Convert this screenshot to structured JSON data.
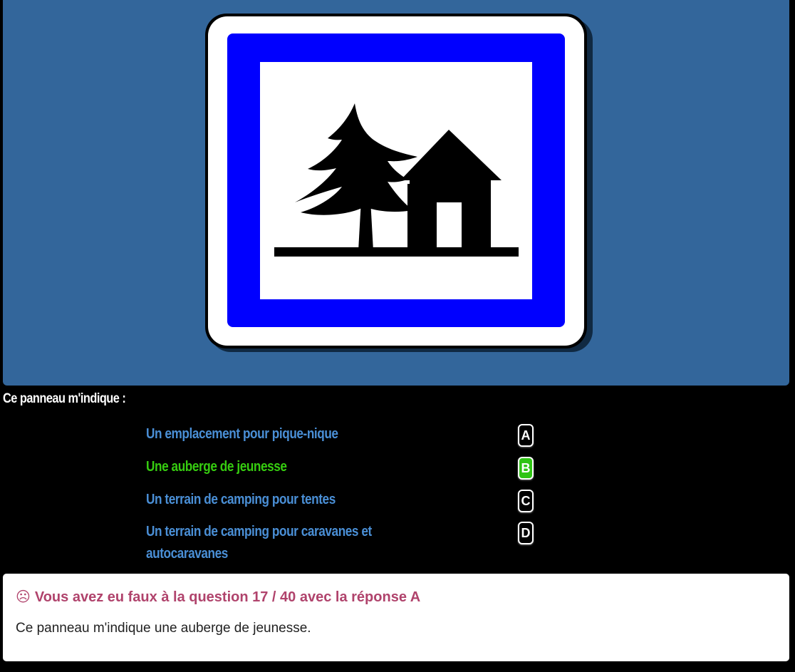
{
  "question": {
    "text": "Ce panneau m'indique :"
  },
  "sign": {
    "icon": "tree-and-house-sign-icon",
    "colors": {
      "background": "#33669b",
      "frame_blue": "#0000ff",
      "inner": "#ffffff",
      "symbol": "#000000"
    }
  },
  "answers": [
    {
      "key": "A",
      "label": "Un emplacement pour pique-nique",
      "state": "default"
    },
    {
      "key": "B",
      "label": "Une auberge de jeunesse",
      "state": "correct"
    },
    {
      "key": "C",
      "label": "Un terrain de camping pour tentes",
      "state": "default"
    },
    {
      "key": "D",
      "label": "Un terrain de camping pour caravanes et autocaravanes",
      "state": "default"
    }
  ],
  "feedback": {
    "icon": "sad-face-icon",
    "icon_glyph": "☹",
    "title": "Vous avez eu faux à la question 17 / 40 avec la réponse A",
    "explanation": "Ce panneau m'indique une auberge de jeunesse."
  },
  "colors": {
    "answer_default": "#4a8fd6",
    "answer_correct": "#36cc10",
    "feedback_title": "#b0436c"
  }
}
